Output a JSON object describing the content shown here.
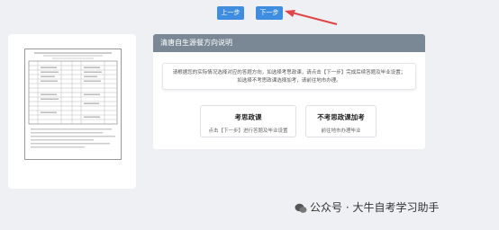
{
  "nav": {
    "prev_label": "上一步",
    "next_label": "下一步"
  },
  "panel": {
    "title": "清唐自生源餐方向说明",
    "notice_line1": "请根据您的实际情况选择对应的答题方向，如选择考思政课，请点击【下一步】完成后续答题及毕业设置；",
    "notice_line2": "如选择不考思政课选择加考，请前往地市办理。",
    "option1": {
      "title": "考思政课",
      "desc": "点击【下一步】进行答题及毕业设置"
    },
    "option2": {
      "title": "不考思政课加考",
      "desc": "前往地市办理毕业"
    }
  },
  "watermark": "公众号 · 大牛自考学习助手",
  "colors": {
    "accent": "#3f8de0",
    "panel_header": "#7a8896",
    "arrow": "#e0454a"
  }
}
